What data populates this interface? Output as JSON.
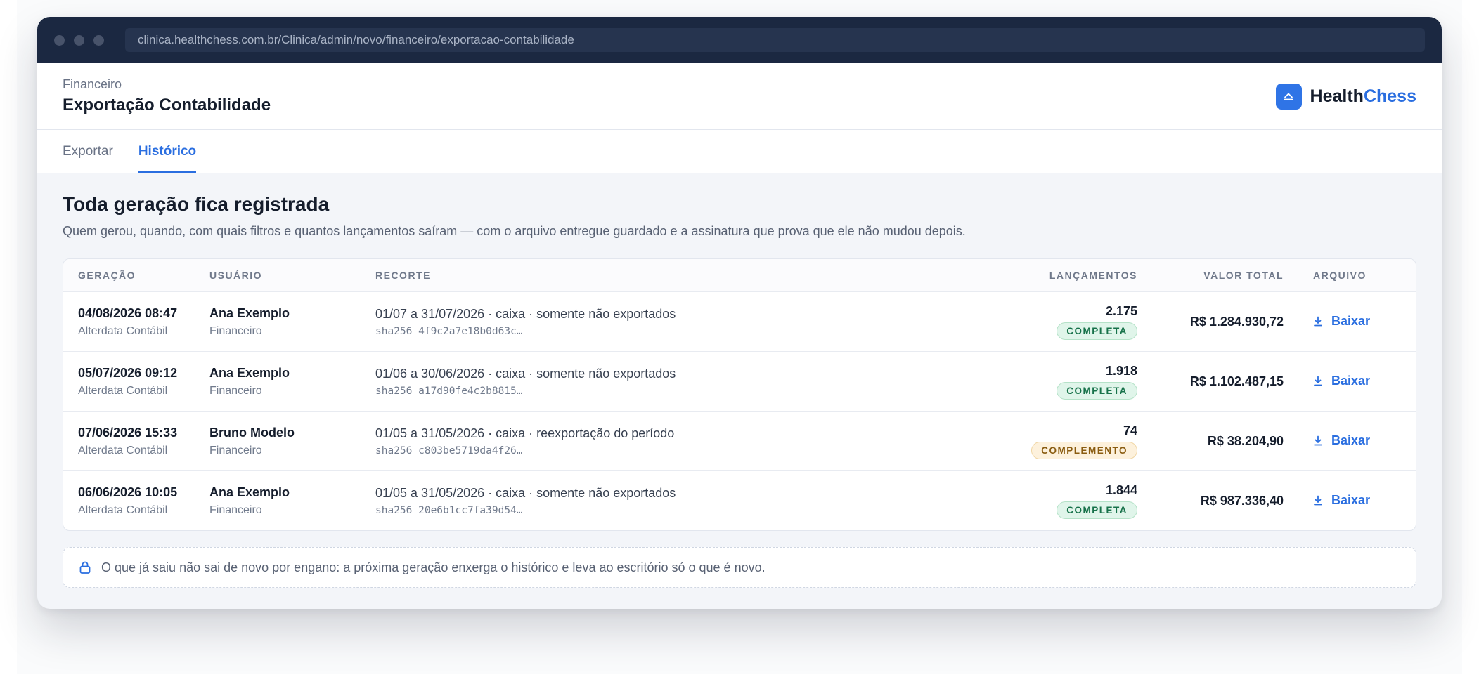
{
  "browser": {
    "url": "clinica.healthchess.com.br/Clinica/admin/novo/financeiro/exportacao-contabilidade"
  },
  "header": {
    "breadcrumb": "Financeiro",
    "title": "Exportação Contabilidade",
    "brand_part1": "Health",
    "brand_part2": "Chess",
    "brand_accent_color": "#2a6ee0"
  },
  "tabs": [
    {
      "label": "Exportar",
      "active": false
    },
    {
      "label": "Histórico",
      "active": true
    }
  ],
  "main": {
    "title": "Toda geração fica registrada",
    "description": "Quem gerou, quando, com quais filtros e quantos lançamentos saíram — com o arquivo entregue guardado e a assinatura que prova que ele não mudou depois."
  },
  "table": {
    "columns": [
      "Geração",
      "Usuário",
      "Recorte",
      "Lançamentos",
      "Valor total",
      "Arquivo"
    ],
    "rows": [
      {
        "date": "04/08/2026 08:47",
        "system": "Alterdata Contábil",
        "user": "Ana Exemplo",
        "role": "Financeiro",
        "cut": "01/07 a 31/07/2026 · caixa · somente não exportados",
        "hash": "sha256 4f9c2a7e18b0d63c…",
        "count": "2.175",
        "status": "COMPLETA",
        "status_kind": "ok",
        "total": "R$ 1.284.930,72",
        "action": "Baixar"
      },
      {
        "date": "05/07/2026 09:12",
        "system": "Alterdata Contábil",
        "user": "Ana Exemplo",
        "role": "Financeiro",
        "cut": "01/06 a 30/06/2026 · caixa · somente não exportados",
        "hash": "sha256 a17d90fe4c2b8815…",
        "count": "1.918",
        "status": "COMPLETA",
        "status_kind": "ok",
        "total": "R$ 1.102.487,15",
        "action": "Baixar"
      },
      {
        "date": "07/06/2026 15:33",
        "system": "Alterdata Contábil",
        "user": "Bruno Modelo",
        "role": "Financeiro",
        "cut": "01/05 a 31/05/2026 · caixa · reexportação do período",
        "hash": "sha256 c803be5719da4f26…",
        "count": "74",
        "status": "COMPLEMENTO",
        "status_kind": "warn",
        "total": "R$ 38.204,90",
        "action": "Baixar"
      },
      {
        "date": "06/06/2026 10:05",
        "system": "Alterdata Contábil",
        "user": "Ana Exemplo",
        "role": "Financeiro",
        "cut": "01/05 a 31/05/2026 · caixa · somente não exportados",
        "hash": "sha256 20e6b1cc7fa39d54…",
        "count": "1.844",
        "status": "COMPLETA",
        "status_kind": "ok",
        "total": "R$ 987.336,40",
        "action": "Baixar"
      }
    ]
  },
  "note": {
    "icon": "lock-icon",
    "text": "O que já saiu não sai de novo por engano: a próxima geração enxerga o histórico e leva ao escritório só o que é novo."
  }
}
